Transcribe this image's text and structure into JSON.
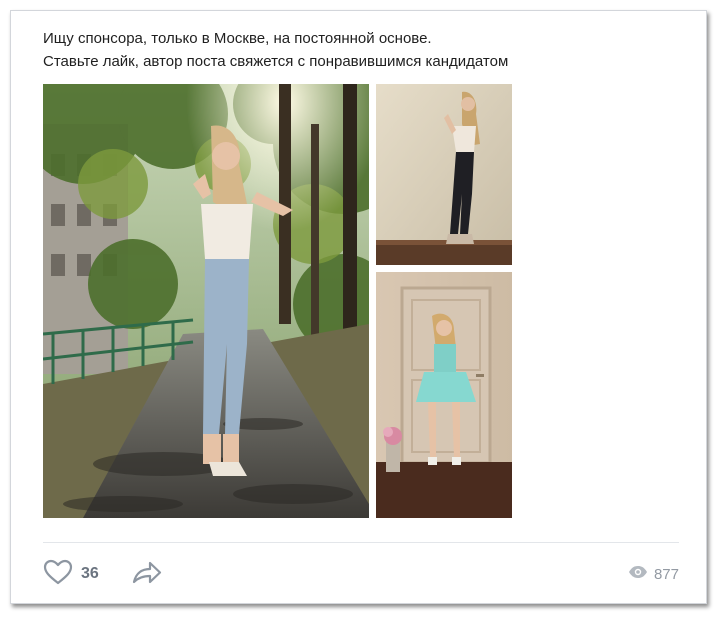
{
  "post": {
    "text_line1": "Ищу спонсора, только в Москве, на постоянной основе.",
    "text_line2": "Ставьте лайк, автор поста свяжется с понравившимся кандидатом"
  },
  "photos": [
    {
      "description": "girl-in-park-photo"
    },
    {
      "description": "girl-in-black-jeans-photo"
    },
    {
      "description": "girl-in-turquoise-dress-photo"
    }
  ],
  "footer": {
    "likes": "36",
    "views": "877",
    "icons": {
      "like": "heart-icon",
      "share": "share-arrow-icon",
      "views": "eye-icon"
    }
  },
  "colors": {
    "icon": "#8d96a1",
    "text": "#1f1f1f",
    "count": "#6b7480",
    "views": "#939aa3"
  }
}
